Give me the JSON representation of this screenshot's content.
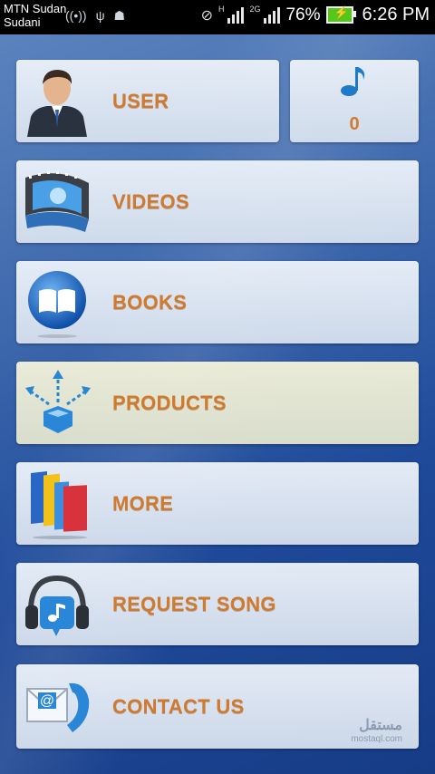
{
  "status_bar": {
    "carrier_line1": "MTN Sudan",
    "carrier_line2": "Sudani",
    "network_h": "H",
    "network_2g": "2G",
    "battery_percent": "76%",
    "time": "6:26 PM",
    "battery_color": "#55c61b"
  },
  "menu": {
    "user_label": "USER",
    "song_count": "0",
    "videos_label": "VIDEOS",
    "books_label": "BOOKS",
    "products_label": "PRODUCTS",
    "more_label": "MORE",
    "request_song_label": "REQUEST SONG",
    "contact_label": "CONTACT US",
    "highlighted_item": "products"
  },
  "theme": {
    "label_color": "#cf7a2e",
    "background": "#1f4a9a"
  },
  "watermark": {
    "logo_text": "مستقل",
    "site": "mostaql.com"
  }
}
